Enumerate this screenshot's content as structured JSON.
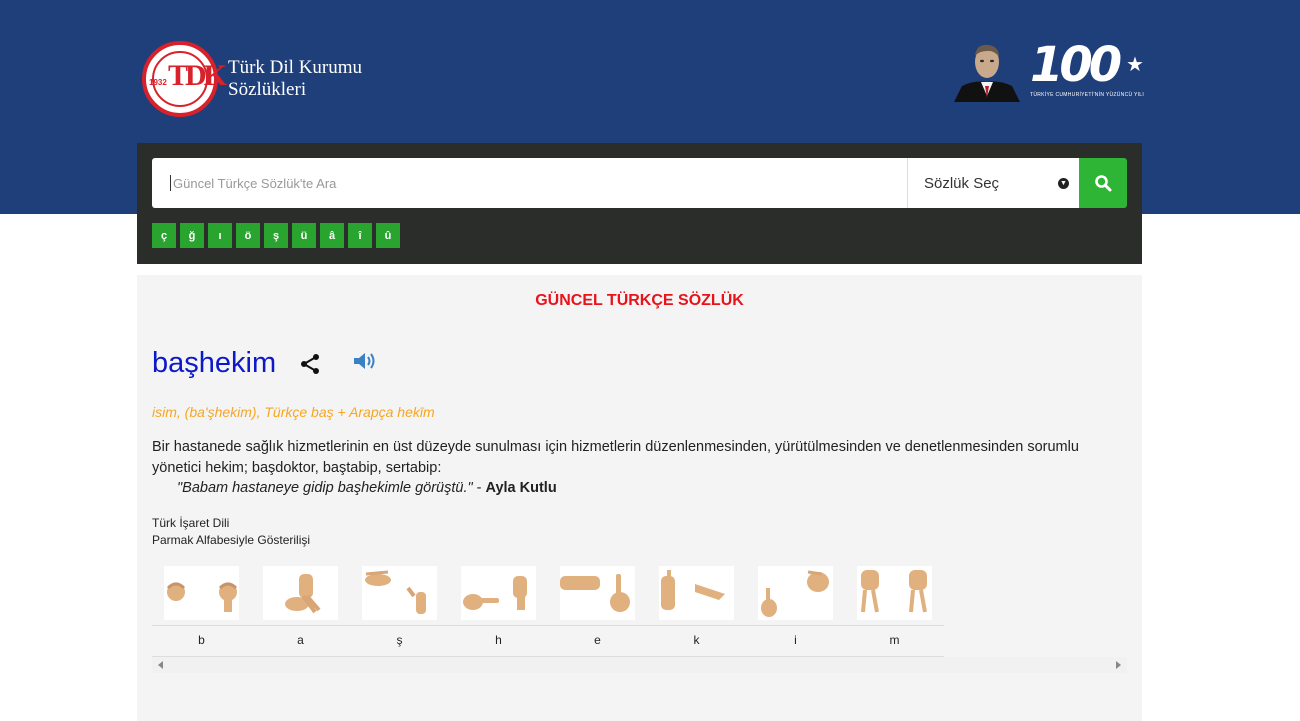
{
  "header": {
    "logo_year": "1932",
    "logo_letters": "TDK",
    "brand_line1": "Türk Dil Kurumu",
    "brand_line2": "Sözlükleri",
    "centennial_number": "100",
    "centennial_caption": "TÜRKİYE CUMHURİYETİ'NİN YÜZÜNCÜ YILI"
  },
  "search": {
    "placeholder": "Güncel Türkçe Sözlük'te Ara",
    "dictionary_select": "Sözlük Seç",
    "special_chars": [
      "ç",
      "ğ",
      "ı",
      "ö",
      "ş",
      "ü",
      "â",
      "î",
      "û"
    ]
  },
  "entry": {
    "dictionary_title": "GÜNCEL TÜRKÇE SÖZLÜK",
    "word": "başhekim",
    "meta": "isim, (ba'şhekim), Türkçe baş + Arapça hekīm",
    "definition": "Bir hastanede sağlık hizmetlerinin en üst düzeyde sunulması için hizmetlerin düzenlenmesinden, yürütülmesinden ve denetlenmesinden sorumlu yönetici hekim; başdoktor, baştabip, sertabip:",
    "example_text": "\"Babam hastaneye gidip başhekimle görüştü.\"",
    "example_sep": " - ",
    "example_author": "Ayla Kutlu",
    "sign_label_1": "Türk İşaret Dili",
    "sign_label_2": "Parmak Alfabesiyle Gösterilişi",
    "sign_letters": [
      "b",
      "a",
      "ş",
      "h",
      "e",
      "k",
      "i",
      "m"
    ]
  },
  "colors": {
    "header_bg": "#1f3f7a",
    "search_panel": "#2b2d2a",
    "accent_green": "#2fb535",
    "title_red": "#e8131b",
    "word_blue": "#0d18c9",
    "meta_orange": "#f5a623"
  }
}
